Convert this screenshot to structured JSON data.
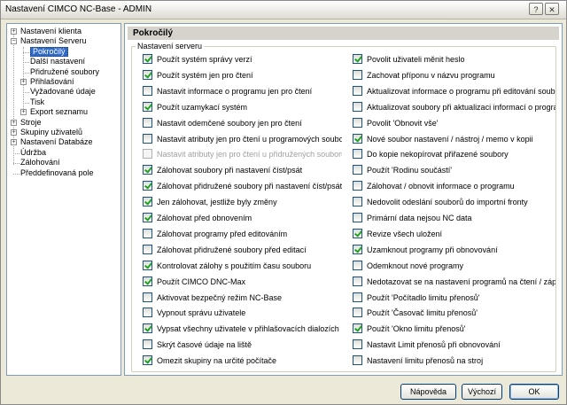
{
  "window": {
    "title": "Nastavení CIMCO NC-Base - ADMIN",
    "help_glyph": "?",
    "close_glyph": "✕"
  },
  "tree": [
    {
      "label": "Nastavení klienta",
      "level": 0,
      "expander": "+"
    },
    {
      "label": "Nastavení Serveru",
      "level": 0,
      "expander": "−"
    },
    {
      "label": "Pokročilý",
      "level": 1,
      "selected": true
    },
    {
      "label": "Další nastavení",
      "level": 1
    },
    {
      "label": "Přidružené soubory",
      "level": 1
    },
    {
      "label": "Přihlašování",
      "level": 1,
      "expander": "+"
    },
    {
      "label": "Vyžadované údaje",
      "level": 1
    },
    {
      "label": "Tisk",
      "level": 1
    },
    {
      "label": "Export seznamu",
      "level": 1,
      "expander": "+"
    },
    {
      "label": "Stroje",
      "level": 0,
      "expander": "+"
    },
    {
      "label": "Skupiny uživatelů",
      "level": 0,
      "expander": "+"
    },
    {
      "label": "Nastavení Databáze",
      "level": 0,
      "expander": "+"
    },
    {
      "label": "Údržba",
      "level": 0
    },
    {
      "label": "Zálohování",
      "level": 0
    },
    {
      "label": "Předdefinovaná pole",
      "level": 0
    }
  ],
  "panel": {
    "title": "Pokročilý",
    "group_title": "Nastavení serveru"
  },
  "left_options": [
    {
      "label": "Použít systém správy verzí",
      "checked": true
    },
    {
      "label": "Použít systém jen pro čtení",
      "checked": true
    },
    {
      "label": "Nastavit informace o programu jen pro čtení",
      "checked": false
    },
    {
      "label": "Použít uzamykací systém",
      "checked": true
    },
    {
      "label": "Nastavit odemčené soubory jen pro čtení",
      "checked": false
    },
    {
      "label": "Nastavit atributy jen pro čtení u programových souborů",
      "checked": false
    },
    {
      "label": "Nastavit atributy jen pro čtení u přidružených souborů",
      "checked": false,
      "disabled": true
    },
    {
      "label": "Zálohovat soubory při nastavení číst/psát",
      "checked": true
    },
    {
      "label": "Zálohovat přidružené soubory při nastavení číst/psát",
      "checked": true
    },
    {
      "label": "Jen zálohovat, jestliže byly změny",
      "checked": true
    },
    {
      "label": "Zálohovat před obnovením",
      "checked": true
    },
    {
      "label": "Zálohovat programy před editováním",
      "checked": false
    },
    {
      "label": "Zálohovat přidružené soubory před editací",
      "checked": false
    },
    {
      "label": "Kontrolovat zálohy s použitím času souboru",
      "checked": true
    },
    {
      "label": "Použít CIMCO DNC-Max",
      "checked": true
    },
    {
      "label": "Aktivovat bezpečný režim NC-Base",
      "checked": false
    },
    {
      "label": "Vypnout správu uživatele",
      "checked": false
    },
    {
      "label": "Vypsat všechny uživatele v přihlašovacích dialozích",
      "checked": true
    },
    {
      "label": "Skrýt časové údaje na liště",
      "checked": false
    },
    {
      "label": "Omezit skupiny na určité počítače",
      "checked": true
    }
  ],
  "right_options": [
    {
      "label": "Povolit uživateli měnit heslo",
      "checked": true
    },
    {
      "label": "Zachovat příponu v názvu programu",
      "checked": false
    },
    {
      "label": "Aktualizovat informace o programu při editování souborů",
      "checked": false
    },
    {
      "label": "Aktualizovat soubory při aktualizaci informací o programu",
      "checked": false
    },
    {
      "label": "Povolit 'Obnovit vše'",
      "checked": false
    },
    {
      "label": "Nové soubor nastavení / nástroj / memo v kopii",
      "checked": true
    },
    {
      "label": "Do kopie nekopírovat přiřazené soubory",
      "checked": false
    },
    {
      "label": "Použít 'Rodinu součástí'",
      "checked": false
    },
    {
      "label": "Zálohovat / obnovit informace o programu",
      "checked": false
    },
    {
      "label": "Nedovolit odeslání souborů do importní fronty",
      "checked": false
    },
    {
      "label": "Primární data nejsou NC data",
      "checked": false
    },
    {
      "label": "Revize všech uložení",
      "checked": true
    },
    {
      "label": "Uzamknout programy při obnovování",
      "checked": true
    },
    {
      "label": "Odemknout nové programy",
      "checked": false
    },
    {
      "label": "Nedotazovat se na nastavení programů na čtení / zápis v ed",
      "checked": false
    },
    {
      "label": "Použít 'Počítadlo limitu přenosů'",
      "checked": false
    },
    {
      "label": "Použít 'Časovač limitu přenosů'",
      "checked": false
    },
    {
      "label": "Použít 'Okno limitu přenosů'",
      "checked": true
    },
    {
      "label": "Nastavit Limit přenosů při obnovování",
      "checked": false
    },
    {
      "label": "Nastavení limitu přenosů na stroj",
      "checked": false
    }
  ],
  "buttons": {
    "help": "Nápověda",
    "defaults": "Výchozí",
    "ok": "OK"
  }
}
